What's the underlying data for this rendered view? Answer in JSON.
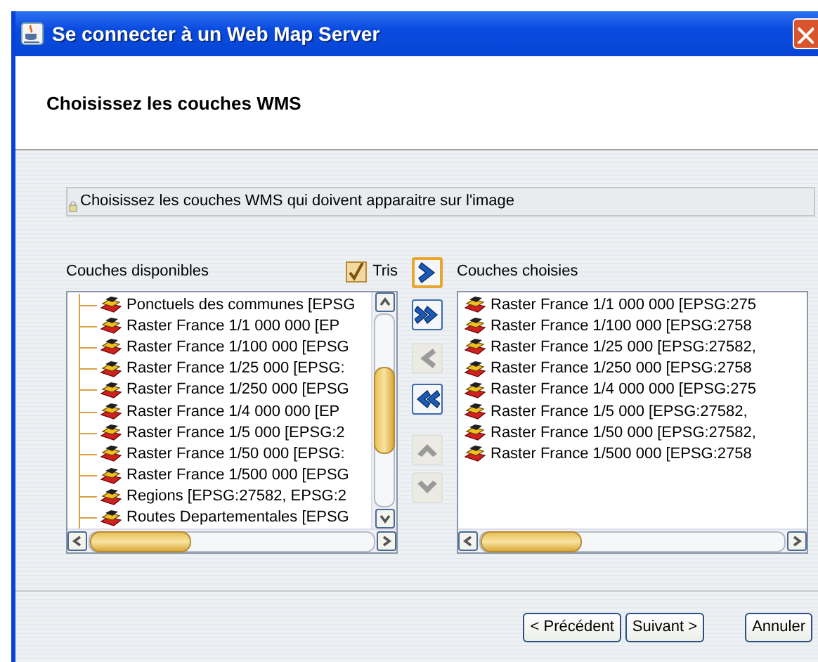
{
  "window": {
    "title": "Se connecter à un Web Map Server"
  },
  "header": {
    "title": "Choisissez les couches WMS"
  },
  "info": {
    "text": "Choisissez les couches WMS qui doivent apparaitre sur l'image"
  },
  "available": {
    "label": "Couches disponibles",
    "items": [
      "Ponctuels des communes [EPSG",
      "Raster France 1/1 000 000 [EP",
      "Raster France 1/100 000 [EPSG",
      "Raster France 1/25 000 [EPSG:",
      "Raster France 1/250 000 [EPSG",
      "Raster France 1/4 000 000 [EP",
      "Raster France 1/5 000 [EPSG:2",
      "Raster France 1/50 000 [EPSG:",
      "Raster France 1/500 000 [EPSG",
      "Regions [EPSG:27582, EPSG:2",
      "Routes Departementales [EPSG"
    ]
  },
  "sort": {
    "label": "Tris",
    "checked": true
  },
  "chosen": {
    "label": "Couches choisies",
    "items": [
      "Raster France 1/1 000 000 [EPSG:275",
      "Raster France 1/100 000 [EPSG:2758",
      "Raster France 1/25 000 [EPSG:27582,",
      "Raster France 1/250 000 [EPSG:2758",
      "Raster France 1/4 000 000 [EPSG:275",
      "Raster France 1/5 000 [EPSG:27582,",
      "Raster France 1/50 000 [EPSG:27582,",
      "Raster France 1/500 000 [EPSG:2758"
    ]
  },
  "transfer_buttons": [
    {
      "kind": "add",
      "disabled": false,
      "focused": true
    },
    {
      "kind": "add_all",
      "disabled": false,
      "focused": false
    },
    {
      "kind": "remove",
      "disabled": true,
      "focused": false
    },
    {
      "kind": "remove_all",
      "disabled": false,
      "focused": false
    },
    {
      "kind": "up",
      "disabled": true,
      "focused": false
    },
    {
      "kind": "down",
      "disabled": true,
      "focused": false
    }
  ],
  "buttons": [
    {
      "label": "< Précédent"
    },
    {
      "label": "Suivant >"
    },
    {
      "label": "Annuler"
    }
  ]
}
